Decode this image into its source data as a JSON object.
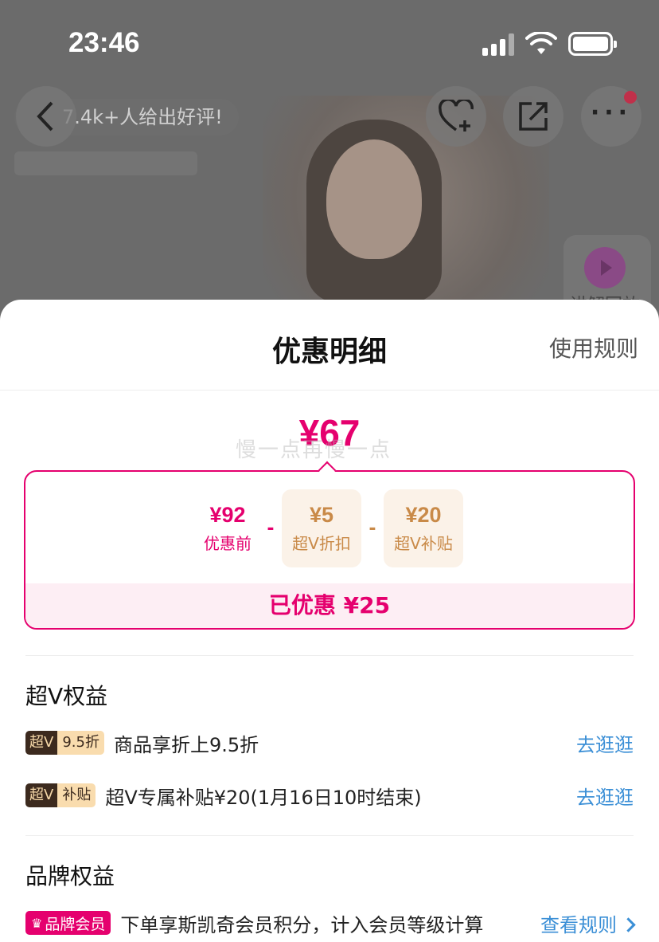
{
  "status_bar": {
    "time": "23:46"
  },
  "background": {
    "review_badge": "7.4k+人给出好评!",
    "replay_label": "讲解回放"
  },
  "sheet": {
    "title": "优惠明细",
    "rules_link": "使用规则",
    "final_price": "¥67",
    "watermark": "慢一点再慢一点",
    "calc": {
      "original": {
        "amount": "¥92",
        "label": "优惠前"
      },
      "minus": "-",
      "discounts": [
        {
          "amount": "¥5",
          "label": "超V折扣"
        },
        {
          "amount": "¥20",
          "label": "超V补贴"
        }
      ],
      "saved": "已优惠 ¥25"
    },
    "super_v": {
      "title": "超V权益",
      "items": [
        {
          "tag_main": "超V",
          "tag_sub": "9.5折",
          "text": "商品享折上9.5折",
          "link": "去逛逛"
        },
        {
          "tag_main": "超V",
          "tag_sub": "补贴",
          "text": "超V专属补贴¥20(1月16日10时结束)",
          "link": "去逛逛"
        }
      ]
    },
    "brand": {
      "title": "品牌权益",
      "item": {
        "tag": "品牌会员",
        "text": "下单享斯凯奇会员积分，计入会员等级计算",
        "link": "查看规则"
      }
    }
  },
  "colors": {
    "accent": "#e5006e",
    "gold": "#c98a48",
    "link": "#3b8fd6"
  }
}
